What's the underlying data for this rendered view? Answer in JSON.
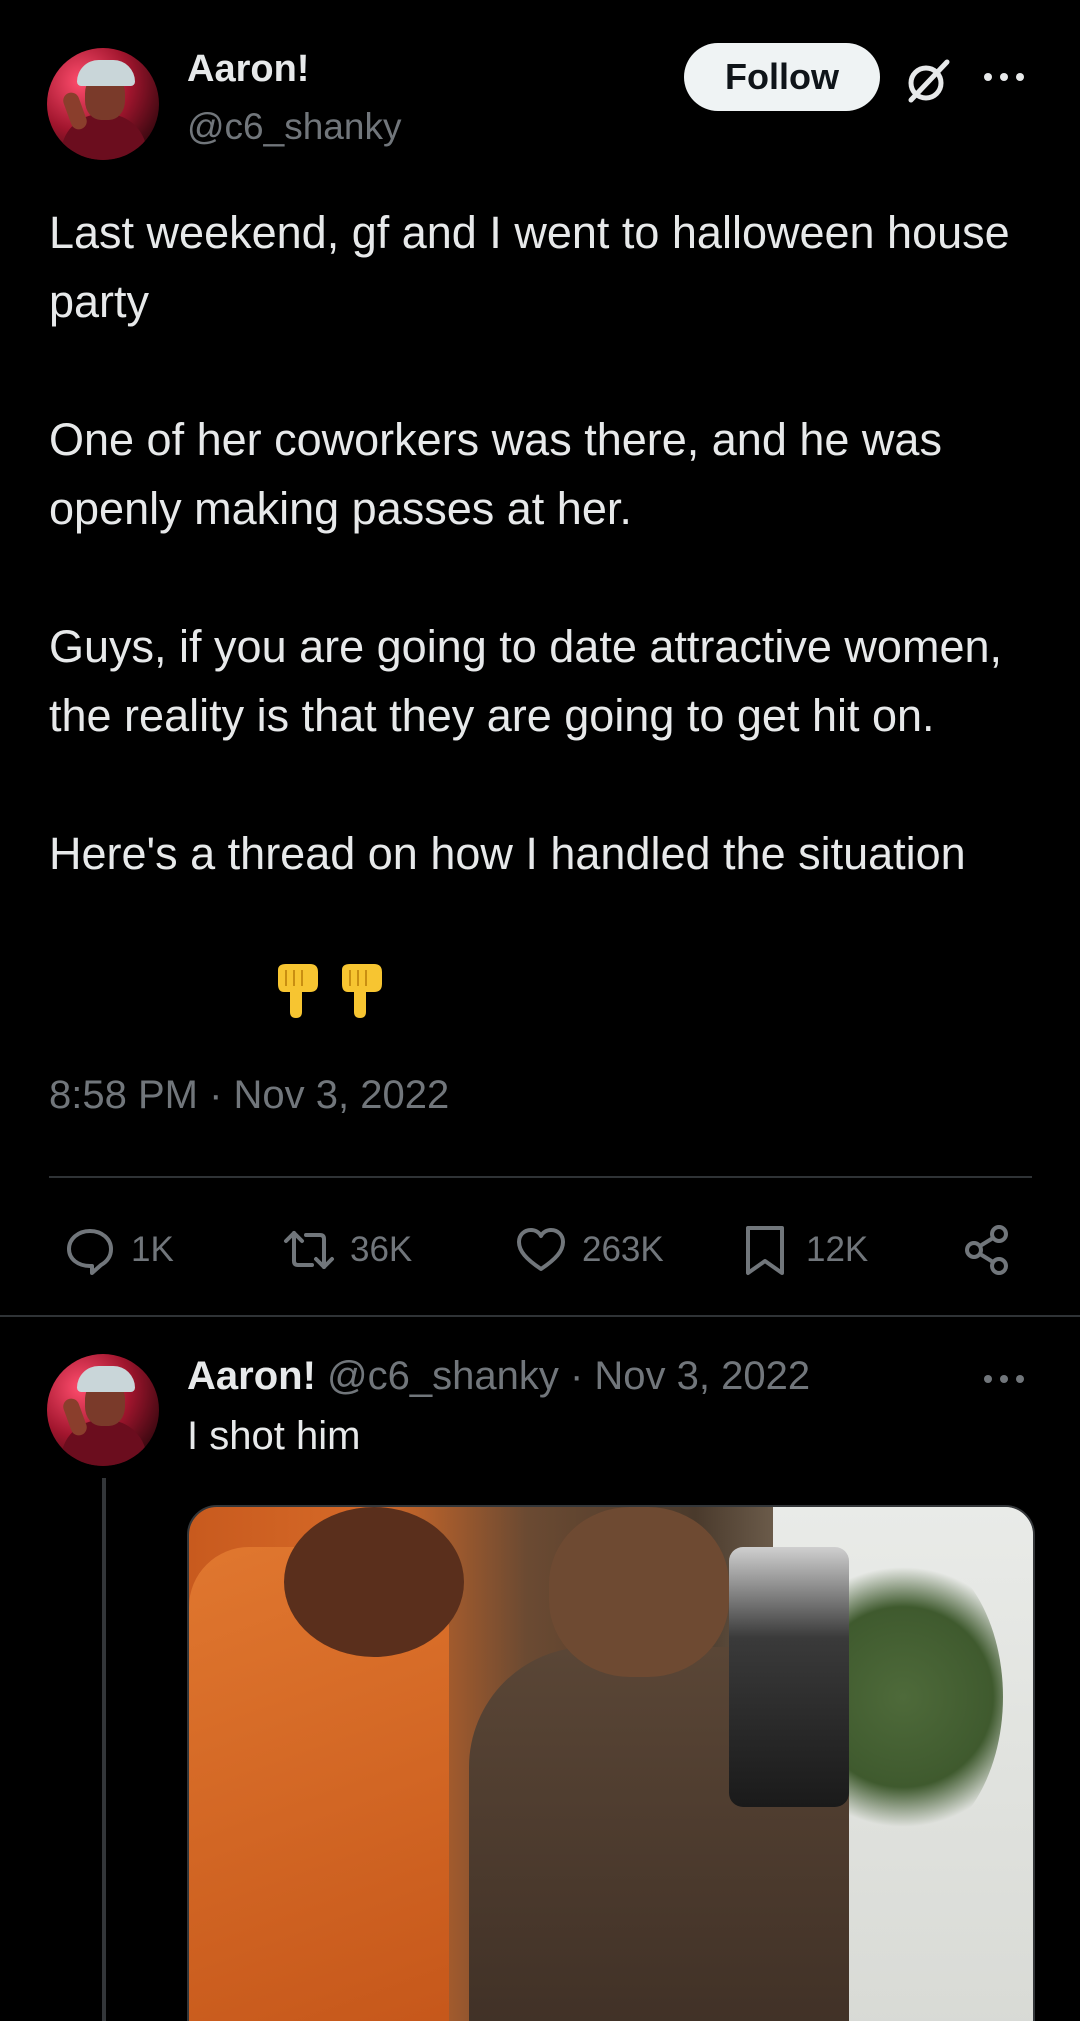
{
  "main_tweet": {
    "author": {
      "display_name": "Aaron!",
      "handle": "@c6_shanky"
    },
    "follow_label": "Follow",
    "paragraphs": [
      "Last weekend, gf and I went to halloween house party",
      "One of her coworkers was there, and he was openly making passes at her.",
      "Guys, if you are going to date attractive women, the reality is that they are going to get hit on.",
      "Here's a thread on how I handled the situation"
    ],
    "timestamp": "8:58 PM · Nov 3, 2022",
    "actions": {
      "replies": "1K",
      "reposts": "36K",
      "likes": "263K",
      "bookmarks": "12K"
    }
  },
  "reply_tweet": {
    "display_name": "Aaron!",
    "meta": "@c6_shanky · Nov 3, 2022",
    "text": "I shot him"
  },
  "icons": {
    "header": [
      "grok-icon",
      "more-icon"
    ],
    "actions": [
      "reply-icon",
      "repost-icon",
      "like-icon",
      "bookmark-icon",
      "share-icon"
    ],
    "emoji": "backhand-index-pointing-down"
  },
  "colors": {
    "background": "#000000",
    "text": "#e7e9ea",
    "secondary": "#71767b",
    "divider": "#2f3336",
    "follow_bg": "#eff3f4",
    "emoji": "#f7c531"
  }
}
